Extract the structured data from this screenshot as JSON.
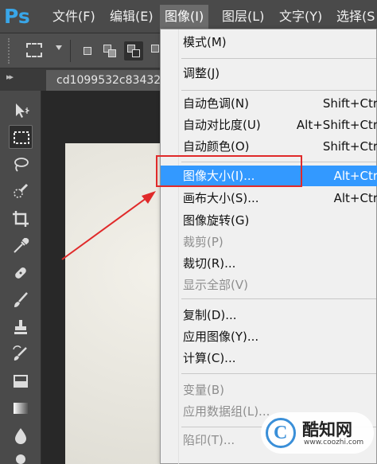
{
  "app": {
    "logo": "Ps",
    "menus": [
      {
        "label": "文件(F)"
      },
      {
        "label": "编辑(E)"
      },
      {
        "label": "图像(I)"
      },
      {
        "label": "图层(L)"
      },
      {
        "label": "文字(Y)"
      },
      {
        "label": "选择(S"
      }
    ],
    "active_menu": "图像(I)"
  },
  "document": {
    "tab_title": "cd1099532c83432"
  },
  "image_menu": {
    "items": [
      {
        "label": "模式(M)",
        "shortcut": "",
        "enabled": true
      },
      {
        "label": "调整(J)",
        "shortcut": "",
        "enabled": true
      },
      {
        "label": "自动色调(N)",
        "shortcut": "Shift+Ctr",
        "enabled": true
      },
      {
        "label": "自动对比度(U)",
        "shortcut": "Alt+Shift+Ctr",
        "enabled": true
      },
      {
        "label": "自动颜色(O)",
        "shortcut": "Shift+Ctr",
        "enabled": true
      },
      {
        "label": "图像大小(I)...",
        "shortcut": "Alt+Ctr",
        "enabled": true,
        "highlighted": true
      },
      {
        "label": "画布大小(S)...",
        "shortcut": "Alt+Ctr",
        "enabled": true
      },
      {
        "label": "图像旋转(G)",
        "shortcut": "",
        "enabled": true
      },
      {
        "label": "裁剪(P)",
        "shortcut": "",
        "enabled": false
      },
      {
        "label": "裁切(R)...",
        "shortcut": "",
        "enabled": true
      },
      {
        "label": "显示全部(V)",
        "shortcut": "",
        "enabled": false
      },
      {
        "label": "复制(D)...",
        "shortcut": "",
        "enabled": true
      },
      {
        "label": "应用图像(Y)...",
        "shortcut": "",
        "enabled": true
      },
      {
        "label": "计算(C)...",
        "shortcut": "",
        "enabled": true
      },
      {
        "label": "变量(B)",
        "shortcut": "",
        "enabled": false
      },
      {
        "label": "应用数据组(L)...",
        "shortcut": "",
        "enabled": false
      },
      {
        "label": "陷印(T)...",
        "shortcut": "",
        "enabled": false
      }
    ]
  },
  "watermark": {
    "name": "酷知网",
    "url": "www.coozhi.com",
    "letter": "C"
  },
  "colors": {
    "accent": "#3399ff",
    "annotation": "#e02a2a",
    "brand": "#39a6e8"
  }
}
